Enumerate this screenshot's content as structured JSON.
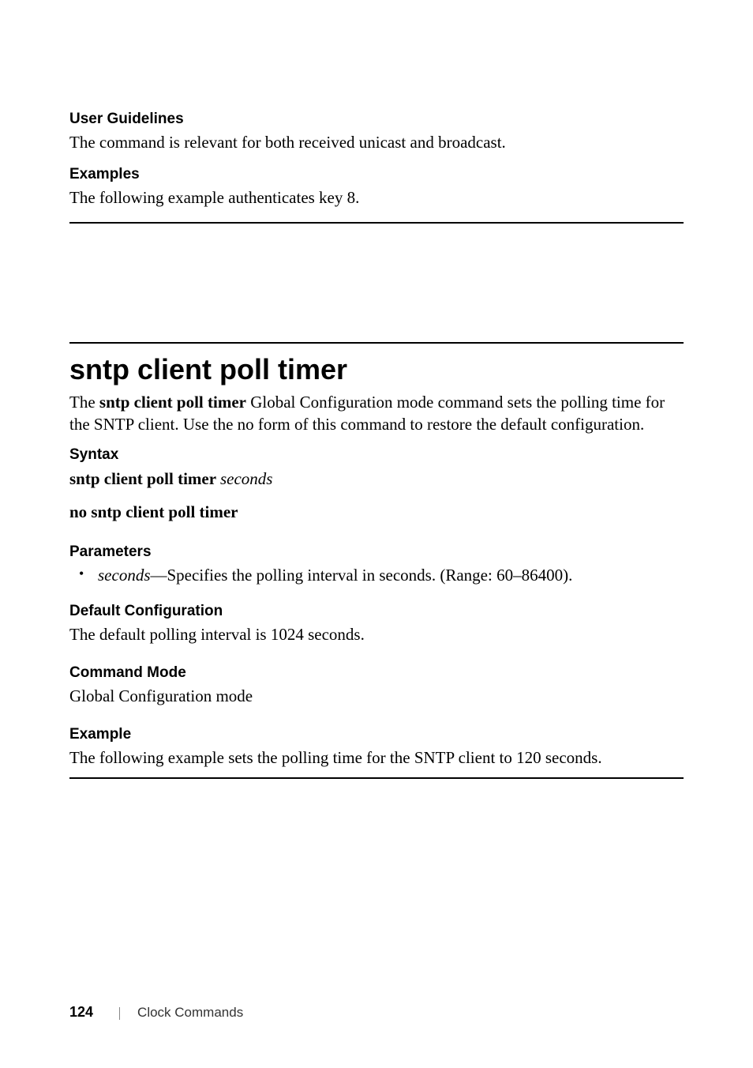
{
  "section1": {
    "userGuidelines": {
      "heading": "User Guidelines",
      "text": "The command is relevant for both received unicast and broadcast."
    },
    "examples": {
      "heading": "Examples",
      "text": "The following example authenticates key 8."
    }
  },
  "section2": {
    "title": "sntp client poll timer",
    "descPrefix": "The ",
    "descBold": "sntp client poll timer",
    "descSuffix": " Global Configuration mode command sets the polling time for the SNTP client. Use the no form of this command to restore the default configuration.",
    "syntax": {
      "heading": "Syntax",
      "line1Bold": "sntp client poll timer ",
      "line1Italic": "seconds",
      "line2Bold": "no sntp client poll timer"
    },
    "parameters": {
      "heading": "Parameters",
      "itemItalic": "seconds",
      "itemText": "—Specifies the polling interval in seconds. (Range: 60–86400)."
    },
    "defaultConfig": {
      "heading": "Default Configuration",
      "text": "The default polling interval is 1024 seconds."
    },
    "commandMode": {
      "heading": "Command Mode",
      "text": "Global Configuration mode"
    },
    "example": {
      "heading": "Example",
      "text": "The following example sets the polling time for the SNTP client to 120 seconds."
    }
  },
  "footer": {
    "page": "124",
    "section": "Clock Commands"
  }
}
